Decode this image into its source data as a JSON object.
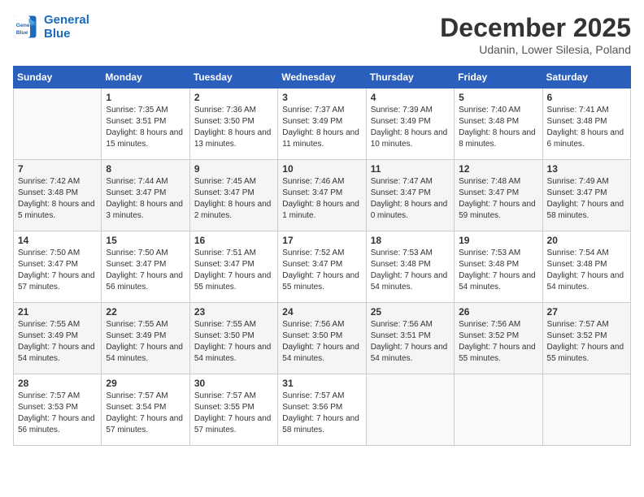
{
  "header": {
    "logo_line1": "General",
    "logo_line2": "Blue",
    "month": "December 2025",
    "location": "Udanin, Lower Silesia, Poland"
  },
  "days_of_week": [
    "Sunday",
    "Monday",
    "Tuesday",
    "Wednesday",
    "Thursday",
    "Friday",
    "Saturday"
  ],
  "weeks": [
    [
      {
        "day": "",
        "sunrise": "",
        "sunset": "",
        "daylight": ""
      },
      {
        "day": "1",
        "sunrise": "Sunrise: 7:35 AM",
        "sunset": "Sunset: 3:51 PM",
        "daylight": "Daylight: 8 hours and 15 minutes."
      },
      {
        "day": "2",
        "sunrise": "Sunrise: 7:36 AM",
        "sunset": "Sunset: 3:50 PM",
        "daylight": "Daylight: 8 hours and 13 minutes."
      },
      {
        "day": "3",
        "sunrise": "Sunrise: 7:37 AM",
        "sunset": "Sunset: 3:49 PM",
        "daylight": "Daylight: 8 hours and 11 minutes."
      },
      {
        "day": "4",
        "sunrise": "Sunrise: 7:39 AM",
        "sunset": "Sunset: 3:49 PM",
        "daylight": "Daylight: 8 hours and 10 minutes."
      },
      {
        "day": "5",
        "sunrise": "Sunrise: 7:40 AM",
        "sunset": "Sunset: 3:48 PM",
        "daylight": "Daylight: 8 hours and 8 minutes."
      },
      {
        "day": "6",
        "sunrise": "Sunrise: 7:41 AM",
        "sunset": "Sunset: 3:48 PM",
        "daylight": "Daylight: 8 hours and 6 minutes."
      }
    ],
    [
      {
        "day": "7",
        "sunrise": "Sunrise: 7:42 AM",
        "sunset": "Sunset: 3:48 PM",
        "daylight": "Daylight: 8 hours and 5 minutes."
      },
      {
        "day": "8",
        "sunrise": "Sunrise: 7:44 AM",
        "sunset": "Sunset: 3:47 PM",
        "daylight": "Daylight: 8 hours and 3 minutes."
      },
      {
        "day": "9",
        "sunrise": "Sunrise: 7:45 AM",
        "sunset": "Sunset: 3:47 PM",
        "daylight": "Daylight: 8 hours and 2 minutes."
      },
      {
        "day": "10",
        "sunrise": "Sunrise: 7:46 AM",
        "sunset": "Sunset: 3:47 PM",
        "daylight": "Daylight: 8 hours and 1 minute."
      },
      {
        "day": "11",
        "sunrise": "Sunrise: 7:47 AM",
        "sunset": "Sunset: 3:47 PM",
        "daylight": "Daylight: 8 hours and 0 minutes."
      },
      {
        "day": "12",
        "sunrise": "Sunrise: 7:48 AM",
        "sunset": "Sunset: 3:47 PM",
        "daylight": "Daylight: 7 hours and 59 minutes."
      },
      {
        "day": "13",
        "sunrise": "Sunrise: 7:49 AM",
        "sunset": "Sunset: 3:47 PM",
        "daylight": "Daylight: 7 hours and 58 minutes."
      }
    ],
    [
      {
        "day": "14",
        "sunrise": "Sunrise: 7:50 AM",
        "sunset": "Sunset: 3:47 PM",
        "daylight": "Daylight: 7 hours and 57 minutes."
      },
      {
        "day": "15",
        "sunrise": "Sunrise: 7:50 AM",
        "sunset": "Sunset: 3:47 PM",
        "daylight": "Daylight: 7 hours and 56 minutes."
      },
      {
        "day": "16",
        "sunrise": "Sunrise: 7:51 AM",
        "sunset": "Sunset: 3:47 PM",
        "daylight": "Daylight: 7 hours and 55 minutes."
      },
      {
        "day": "17",
        "sunrise": "Sunrise: 7:52 AM",
        "sunset": "Sunset: 3:47 PM",
        "daylight": "Daylight: 7 hours and 55 minutes."
      },
      {
        "day": "18",
        "sunrise": "Sunrise: 7:53 AM",
        "sunset": "Sunset: 3:48 PM",
        "daylight": "Daylight: 7 hours and 54 minutes."
      },
      {
        "day": "19",
        "sunrise": "Sunrise: 7:53 AM",
        "sunset": "Sunset: 3:48 PM",
        "daylight": "Daylight: 7 hours and 54 minutes."
      },
      {
        "day": "20",
        "sunrise": "Sunrise: 7:54 AM",
        "sunset": "Sunset: 3:48 PM",
        "daylight": "Daylight: 7 hours and 54 minutes."
      }
    ],
    [
      {
        "day": "21",
        "sunrise": "Sunrise: 7:55 AM",
        "sunset": "Sunset: 3:49 PM",
        "daylight": "Daylight: 7 hours and 54 minutes."
      },
      {
        "day": "22",
        "sunrise": "Sunrise: 7:55 AM",
        "sunset": "Sunset: 3:49 PM",
        "daylight": "Daylight: 7 hours and 54 minutes."
      },
      {
        "day": "23",
        "sunrise": "Sunrise: 7:55 AM",
        "sunset": "Sunset: 3:50 PM",
        "daylight": "Daylight: 7 hours and 54 minutes."
      },
      {
        "day": "24",
        "sunrise": "Sunrise: 7:56 AM",
        "sunset": "Sunset: 3:50 PM",
        "daylight": "Daylight: 7 hours and 54 minutes."
      },
      {
        "day": "25",
        "sunrise": "Sunrise: 7:56 AM",
        "sunset": "Sunset: 3:51 PM",
        "daylight": "Daylight: 7 hours and 54 minutes."
      },
      {
        "day": "26",
        "sunrise": "Sunrise: 7:56 AM",
        "sunset": "Sunset: 3:52 PM",
        "daylight": "Daylight: 7 hours and 55 minutes."
      },
      {
        "day": "27",
        "sunrise": "Sunrise: 7:57 AM",
        "sunset": "Sunset: 3:52 PM",
        "daylight": "Daylight: 7 hours and 55 minutes."
      }
    ],
    [
      {
        "day": "28",
        "sunrise": "Sunrise: 7:57 AM",
        "sunset": "Sunset: 3:53 PM",
        "daylight": "Daylight: 7 hours and 56 minutes."
      },
      {
        "day": "29",
        "sunrise": "Sunrise: 7:57 AM",
        "sunset": "Sunset: 3:54 PM",
        "daylight": "Daylight: 7 hours and 57 minutes."
      },
      {
        "day": "30",
        "sunrise": "Sunrise: 7:57 AM",
        "sunset": "Sunset: 3:55 PM",
        "daylight": "Daylight: 7 hours and 57 minutes."
      },
      {
        "day": "31",
        "sunrise": "Sunrise: 7:57 AM",
        "sunset": "Sunset: 3:56 PM",
        "daylight": "Daylight: 7 hours and 58 minutes."
      },
      {
        "day": "",
        "sunrise": "",
        "sunset": "",
        "daylight": ""
      },
      {
        "day": "",
        "sunrise": "",
        "sunset": "",
        "daylight": ""
      },
      {
        "day": "",
        "sunrise": "",
        "sunset": "",
        "daylight": ""
      }
    ]
  ]
}
